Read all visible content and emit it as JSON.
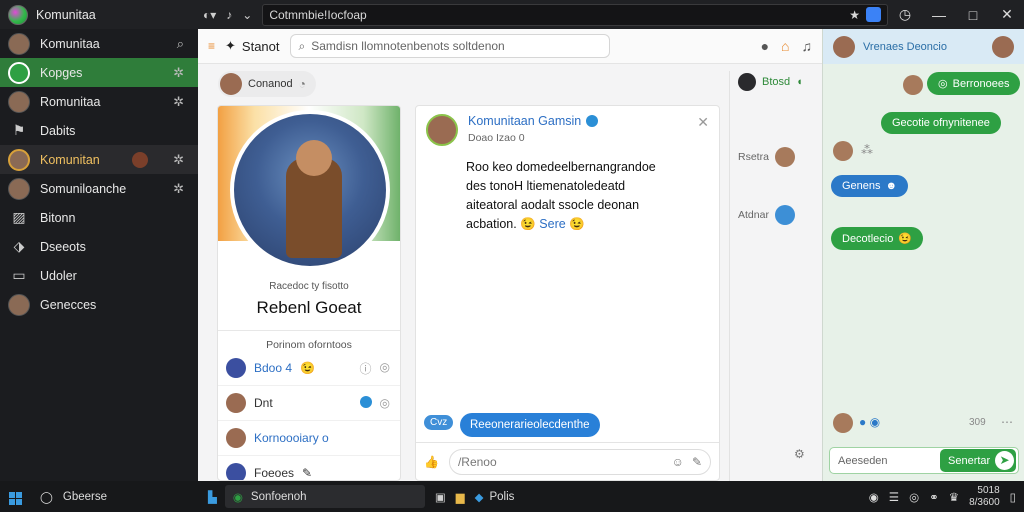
{
  "titlebar": {
    "app_name": "Komunitaa",
    "address": "Cotmmbie!Iocfoap"
  },
  "sidebar": {
    "items": [
      {
        "label": "Komunitaa",
        "icon": "search-icon"
      },
      {
        "label": "Kopges",
        "icon": "settings-icon"
      },
      {
        "label": "Romunitaa",
        "icon": "settings-icon"
      },
      {
        "label": "Dabits",
        "icon": ""
      },
      {
        "label": "Komunitan",
        "icon": "settings-icon"
      },
      {
        "label": "Somuniloanche",
        "icon": "settings-icon"
      },
      {
        "label": "Bitonn",
        "icon": ""
      },
      {
        "label": "Dseeots",
        "icon": ""
      },
      {
        "label": "Udoler",
        "icon": ""
      },
      {
        "label": "Genecces",
        "icon": ""
      }
    ]
  },
  "toolbar": {
    "title": "Stanot",
    "search_placeholder": "Samdisn llomnotenbenots soltdenon"
  },
  "chip": {
    "label": "Conanod"
  },
  "profile": {
    "subtitle": "Racedoc ty fisotto",
    "name": "Rebenl Goeat",
    "section": "Porinom oforntoos",
    "rows": [
      {
        "label": "Bdoo 4"
      },
      {
        "label": "Dnt"
      },
      {
        "label": "Kornoooiary o"
      },
      {
        "label": "Foeoes"
      }
    ]
  },
  "post": {
    "author": "Komunitaan Gamsin",
    "meta": "Doao Izao 0",
    "body": "Roo keo  domedeelbernangrandoe  des tonoH  ltiemenatoledeatd  aiteatoral aodalt ssocle deonan acbation.",
    "emoji_label": "Sere",
    "reply": "Reeonerarieolecdenthe",
    "small": "Cvz",
    "compose_placeholder": "/Renoo"
  },
  "rightlist": {
    "top": "Btosd",
    "items": [
      {
        "label": "Rsetra"
      },
      {
        "label": "Atdnar"
      }
    ]
  },
  "chat": {
    "header": "Vrenaes Deoncio",
    "messages": [
      {
        "text": "Berronoees",
        "color": "green"
      },
      {
        "text": "Gecotie ofnynitenee",
        "color": "green"
      },
      {
        "text": "Genens",
        "color": "blue"
      },
      {
        "text": "Decotlecio",
        "color": "green"
      }
    ],
    "counter": "309",
    "input_placeholder": "Aeeseden",
    "send_label": "Senertar"
  },
  "taskbar": {
    "search": "Gbeerse",
    "task": "Sonfoenoh",
    "app": "Polis",
    "clock_time": "5018",
    "clock_date": "8/3600"
  },
  "colors": {
    "accent_green": "#2ea043",
    "accent_blue": "#2b79c8"
  }
}
